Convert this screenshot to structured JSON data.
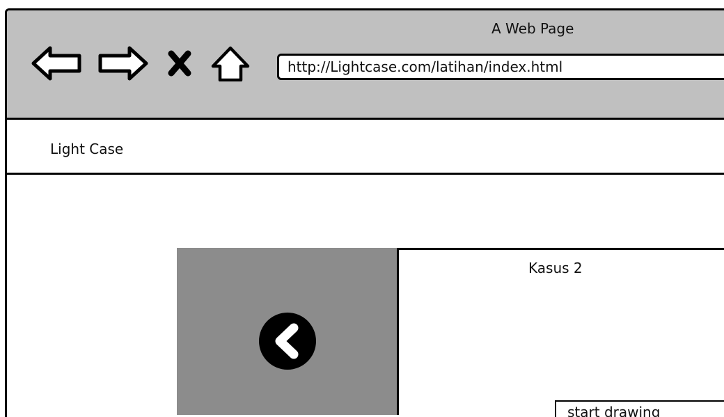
{
  "browser": {
    "title": "A Web Page",
    "url": "http://Lightcase.com/latihan/index.html",
    "icons": [
      "back-arrow-icon",
      "forward-arrow-icon",
      "stop-icon",
      "home-icon"
    ]
  },
  "site": {
    "brand": "Light Case"
  },
  "lightbox": {
    "title": "Kasus 2",
    "prev_icon": "chevron-left-icon",
    "start_label": "start drawing"
  },
  "colors": {
    "chrome": "#c0c0c0",
    "image_area": "#8c8c8c",
    "border": "#000000"
  }
}
